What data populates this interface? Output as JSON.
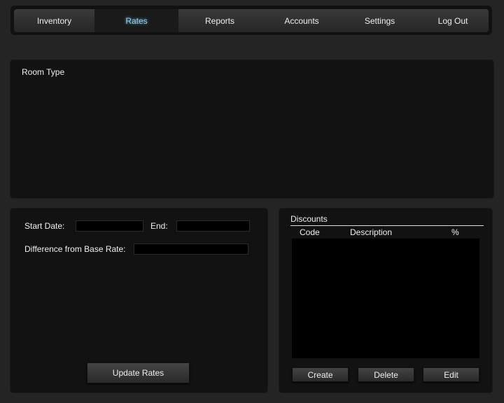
{
  "nav": {
    "tabs": [
      {
        "label": "Inventory"
      },
      {
        "label": "Rates",
        "active": true
      },
      {
        "label": "Reports"
      },
      {
        "label": "Accounts"
      },
      {
        "label": "Settings"
      },
      {
        "label": "Log Out"
      }
    ]
  },
  "room_type": {
    "title": "Room Type"
  },
  "rates_form": {
    "start_label": "Start Date:",
    "start_value": "",
    "end_label": "End:",
    "end_value": "",
    "diff_label": "Difference from Base Rate:",
    "diff_value": "",
    "update_button": "Update Rates"
  },
  "discounts": {
    "title": "Discounts",
    "columns": [
      "Code",
      "Description",
      "%"
    ],
    "rows": [],
    "buttons": {
      "create": "Create",
      "delete": "Delete",
      "edit": "Edit"
    }
  }
}
